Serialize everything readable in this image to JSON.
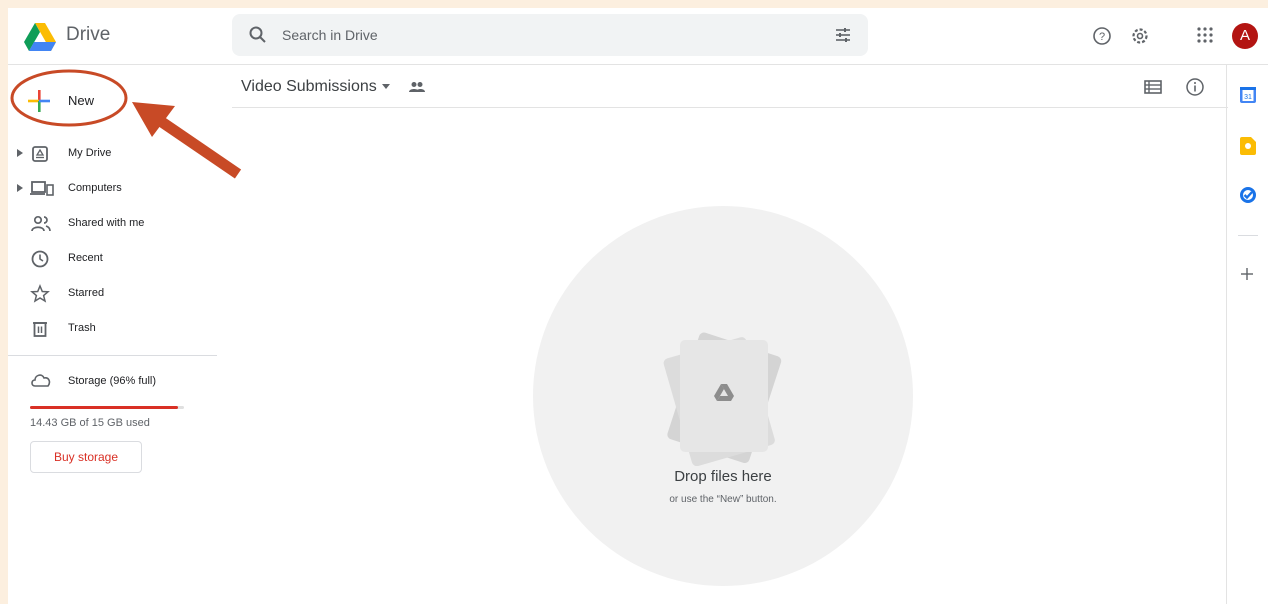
{
  "app": {
    "brand": "Drive"
  },
  "search": {
    "placeholder": "Search in Drive"
  },
  "header": {
    "avatar_initial": "A"
  },
  "sidebar": {
    "new_label": "New",
    "items": [
      {
        "label": "My Drive"
      },
      {
        "label": "Computers"
      },
      {
        "label": "Shared with me"
      },
      {
        "label": "Recent"
      },
      {
        "label": "Starred"
      },
      {
        "label": "Trash"
      }
    ],
    "storage": {
      "label": "Storage (96% full)",
      "used_text": "14.43 GB of 15 GB used",
      "fraction_used": 0.96,
      "buy_label": "Buy storage"
    }
  },
  "main": {
    "folder_title": "Video Submissions",
    "empty": {
      "title": "Drop files here",
      "subtitle": "or use the “New” button."
    }
  },
  "side_panel": {
    "calendar_day": "31"
  },
  "colors": {
    "annotation": "#c84a26",
    "avatar": "#b31412",
    "storage_fill": "#d93025",
    "page_background": "#fcefdf"
  }
}
